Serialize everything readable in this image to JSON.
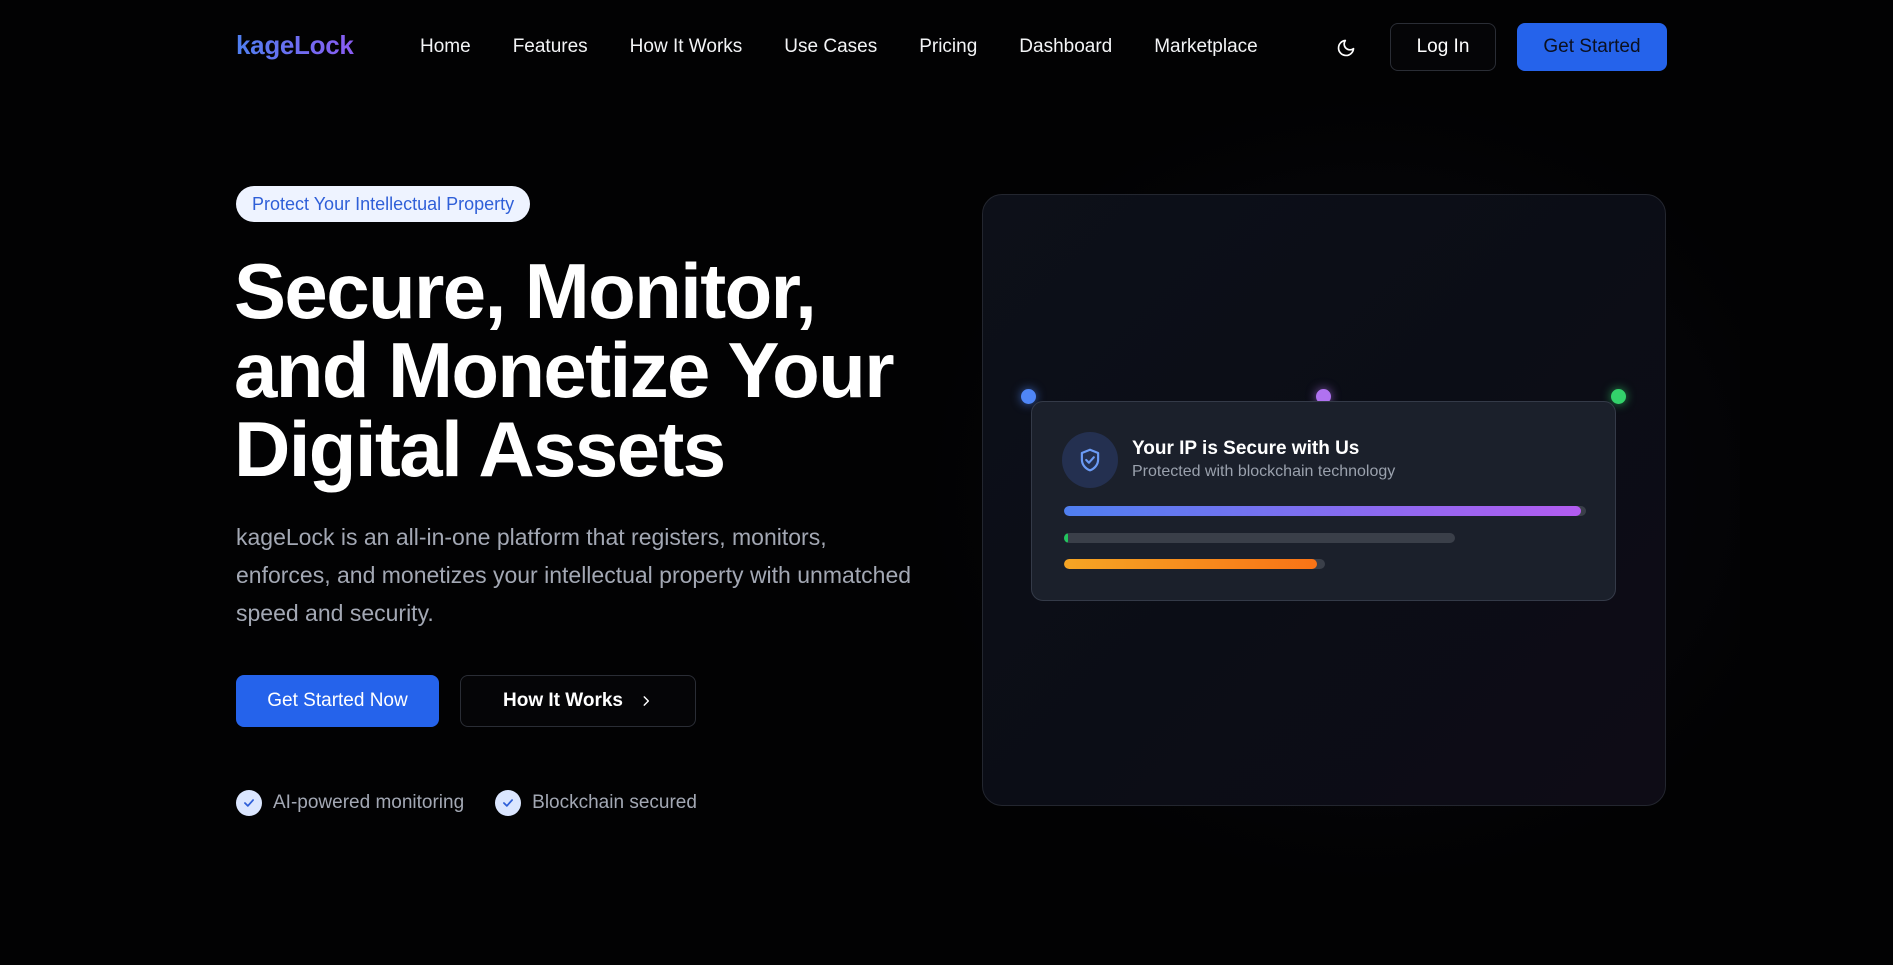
{
  "header": {
    "logo": "kageLock",
    "nav": [
      "Home",
      "Features",
      "How It Works",
      "Use Cases",
      "Pricing",
      "Dashboard",
      "Marketplace"
    ],
    "theme_icon": "moon-icon",
    "login_label": "Log In",
    "get_started_label": "Get Started"
  },
  "hero": {
    "badge": "Protect Your Intellectual Property",
    "title_lines": [
      "Secure, Monitor,",
      "and Monetize Your",
      "Digital Assets"
    ],
    "description": "kageLock is an all-in-one platform that registers, monitors, enforces, and monetizes your intellectual property with unmatched speed and security.",
    "cta_primary": "Get Started Now",
    "cta_secondary": "How It Works",
    "cta_secondary_icon": "chevron-right-icon",
    "features": [
      {
        "label": "AI-powered monitoring",
        "icon": "check-icon"
      },
      {
        "label": "Blockchain secured",
        "icon": "check-icon"
      }
    ]
  },
  "visual": {
    "card_icon": "shield-check-icon",
    "card_title": "Your IP is Secure with Us",
    "card_subtitle": "Protected with blockchain technology",
    "progress_bars": [
      {
        "name": "bar-1",
        "fill": 0.99,
        "colors": [
          "#4f7ff0",
          "#b35cf0"
        ]
      },
      {
        "name": "bar-2",
        "fill": 0.01,
        "colors": [
          "#22c55e",
          "#22c55e"
        ]
      },
      {
        "name": "bar-3",
        "fill": 0.97,
        "colors": [
          "#f5a524",
          "#f97316"
        ]
      }
    ],
    "dot_colors": [
      "#4f86f7",
      "#b072f0",
      "#33d26b"
    ]
  },
  "colors": {
    "accent": "#2563eb",
    "background": "#020203",
    "muted_text": "#a3a8b4"
  }
}
